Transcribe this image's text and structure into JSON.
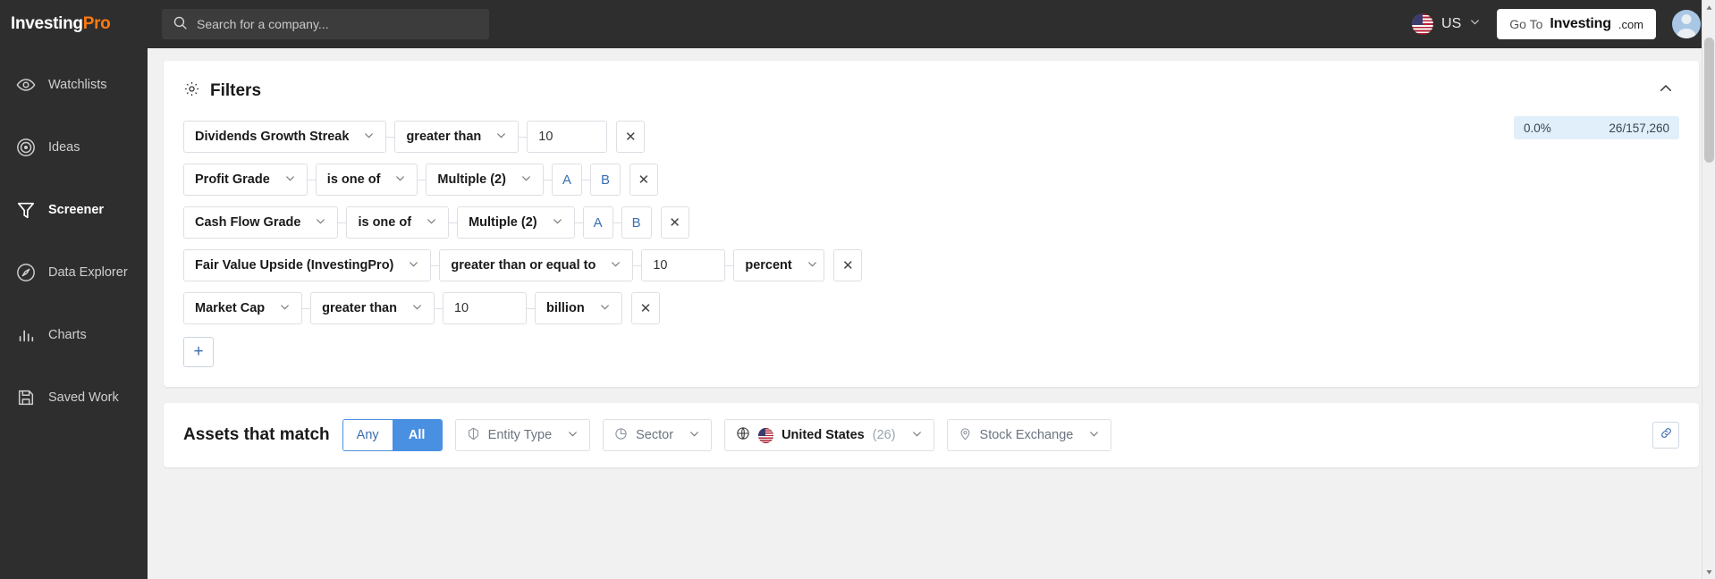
{
  "header": {
    "logo": {
      "first": "Investing",
      "second": "Pro"
    },
    "search": {
      "placeholder": "Search for a company...",
      "value": "",
      "icon": "search-icon"
    },
    "country": {
      "label": "US",
      "flag": "us-flag-icon",
      "caret": "⌄"
    },
    "goto": {
      "prefix": "Go To",
      "brand": "Investing",
      "domain": ".com"
    },
    "avatar": "user-avatar"
  },
  "sidebar": {
    "items": [
      {
        "label": "Watchlists",
        "icon": "eye-icon",
        "active": false
      },
      {
        "label": "Ideas",
        "icon": "target-icon",
        "active": false
      },
      {
        "label": "Screener",
        "icon": "funnel-icon",
        "active": true
      },
      {
        "label": "Data Explorer",
        "icon": "compass-icon",
        "active": false
      },
      {
        "label": "Charts",
        "icon": "bar-chart-icon",
        "active": false
      },
      {
        "label": "Saved Work",
        "icon": "save-icon",
        "active": false
      }
    ]
  },
  "filters": {
    "title": "Filters",
    "gear_icon": "gear-icon",
    "collapse_icon": "chevron-up-icon",
    "add_label": "+",
    "match": {
      "percent": "0.0%",
      "count": "26/157,260"
    },
    "rows": [
      {
        "field": "Dividends Growth Streak",
        "operator": "greater than",
        "value": "10",
        "unit": null,
        "chips": [],
        "remove": "✕"
      },
      {
        "field": "Profit Grade",
        "operator": "is one of",
        "value": "Multiple (2)",
        "unit": null,
        "chips": [
          "A",
          "B"
        ],
        "remove": "✕"
      },
      {
        "field": "Cash Flow Grade",
        "operator": "is one of",
        "value": "Multiple (2)",
        "unit": null,
        "chips": [
          "A",
          "B"
        ],
        "remove": "✕"
      },
      {
        "field": "Fair Value Upside (InvestingPro)",
        "operator": "greater than or equal to",
        "value": "10",
        "unit": "percent",
        "chips": [],
        "remove": "✕"
      },
      {
        "field": "Market Cap",
        "operator": "greater than",
        "value": "10",
        "unit": "billion",
        "chips": [],
        "remove": "✕"
      }
    ]
  },
  "assets": {
    "label": "Assets that match",
    "toggle": {
      "any": "Any",
      "all": "All",
      "selected": "All"
    },
    "pills": [
      {
        "label": "Entity Type",
        "icon": "cube-icon",
        "selected": false,
        "count": null
      },
      {
        "label": "Sector",
        "icon": "pie-icon",
        "selected": false,
        "count": null
      },
      {
        "label": "United States",
        "icon": "globe-icon",
        "flag": "us-flag-icon",
        "selected": true,
        "count": "(26)"
      },
      {
        "label": "Stock Exchange",
        "icon": "pin-icon",
        "selected": false,
        "count": null
      }
    ],
    "link_icon": "link-icon"
  },
  "colors": {
    "accent": "#4a90e2",
    "brand_orange": "#ff7a10",
    "sidebar_bg": "#2e2e2e",
    "badge_bg": "#e1effb"
  }
}
